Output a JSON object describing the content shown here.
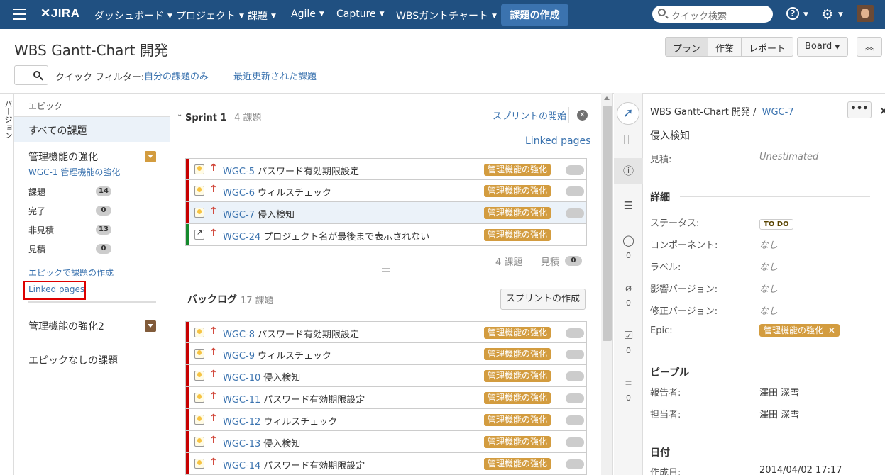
{
  "nav": {
    "logo": "JIRA",
    "items": [
      {
        "label": "ダッシュボード"
      },
      {
        "label": "プロジェクト"
      },
      {
        "label": "課題"
      },
      {
        "label": "Agile"
      },
      {
        "label": "Capture"
      },
      {
        "label": "WBSガントチャート"
      }
    ],
    "create_label": "課題の作成",
    "search_placeholder": "クイック検索",
    "help_label": "?"
  },
  "header": {
    "title": "WBS Gantt-Chart 開発",
    "modes": [
      "プラン",
      "作業",
      "レポート"
    ],
    "board_label": "Board"
  },
  "quick_filters": {
    "label": "クイック フィルター:",
    "items": [
      "自分の課題のみ",
      "最近更新された課題"
    ]
  },
  "versions_tab": "バージョン",
  "epics": {
    "header": "エピック",
    "all_label": "すべての課題",
    "epic1": {
      "name": "管理機能の強化",
      "color": "#d39c3f",
      "sub": "WGC-1 管理機能の強化",
      "stats": [
        {
          "label": "課題",
          "count": "14"
        },
        {
          "label": "完了",
          "count": "0"
        },
        {
          "label": "非見積",
          "count": "13"
        },
        {
          "label": "見積",
          "count": "0"
        }
      ],
      "create_link": "エピックで課題の作成",
      "linked_pages": "Linked pages"
    },
    "epic2": {
      "name": "管理機能の強化2",
      "color": "#815b3a"
    },
    "no_epic": "エピックなしの課題"
  },
  "sprint": {
    "name": "Sprint 1",
    "count": "4 課題",
    "start_label": "スプリントの開始",
    "linked_pages": "Linked pages",
    "issues": [
      {
        "key": "WGC-5",
        "summary": "パスワード有効期限設定",
        "epic": "管理機能の強化"
      },
      {
        "key": "WGC-6",
        "summary": "ウィルスチェック",
        "epic": "管理機能の強化"
      },
      {
        "key": "WGC-7",
        "summary": "侵入検知",
        "epic": "管理機能の強化"
      },
      {
        "key": "WGC-24",
        "summary": "プロジェクト名が最後まで表示されない",
        "epic": "管理機能の強化"
      }
    ],
    "footer_count": "4 課題",
    "footer_est_label": "見積",
    "footer_est": "0"
  },
  "backlog": {
    "name": "バックログ",
    "count": "17 課題",
    "create_sprint": "スプリントの作成",
    "issues": [
      {
        "key": "WGC-8",
        "summary": "パスワード有効期限設定",
        "epic": "管理機能の強化"
      },
      {
        "key": "WGC-9",
        "summary": "ウィルスチェック",
        "epic": "管理機能の強化"
      },
      {
        "key": "WGC-10",
        "summary": "侵入検知",
        "epic": "管理機能の強化"
      },
      {
        "key": "WGC-11",
        "summary": "パスワード有効期限設定",
        "epic": "管理機能の強化"
      },
      {
        "key": "WGC-12",
        "summary": "ウィルスチェック",
        "epic": "管理機能の強化"
      },
      {
        "key": "WGC-13",
        "summary": "侵入検知",
        "epic": "管理機能の強化"
      },
      {
        "key": "WGC-14",
        "summary": "パスワード有効期限設定",
        "epic": "管理機能の強化"
      }
    ]
  },
  "side_icons": {
    "comments": "0",
    "attachments": "0",
    "subtasks": "0",
    "screens": "0"
  },
  "detail": {
    "project": "WBS Gantt-Chart 開発",
    "separator": "/",
    "key": "WGC-7",
    "more": "•••",
    "summary": "侵入検知",
    "estimate_label": "見積:",
    "estimate_value": "Unestimated",
    "details_head": "詳細",
    "fields": [
      {
        "label": "ステータス:",
        "value": "TO DO"
      },
      {
        "label": "コンポーネント:",
        "value": "なし"
      },
      {
        "label": "ラベル:",
        "value": "なし"
      },
      {
        "label": "影響バージョン:",
        "value": "なし"
      },
      {
        "label": "修正バージョン:",
        "value": "なし"
      },
      {
        "label": "Epic:",
        "value": "管理機能の強化"
      }
    ],
    "people_head": "ピープル",
    "reporter_label": "報告者:",
    "reporter": "澤田 深雪",
    "assignee_label": "担当者:",
    "assignee": "澤田 深雪",
    "dates_head": "日付",
    "created_label": "作成日:",
    "created": "2014/04/02 17:17"
  }
}
